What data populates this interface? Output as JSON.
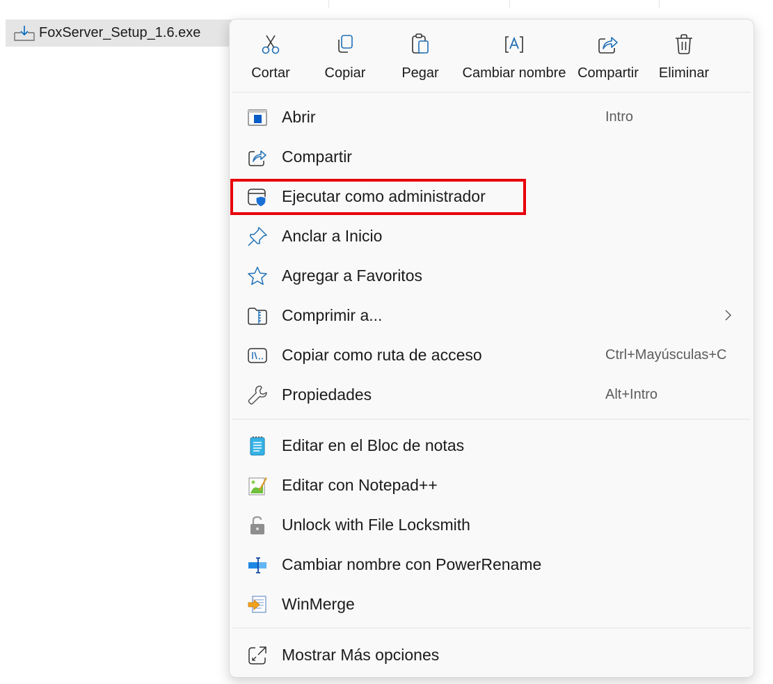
{
  "file": {
    "name": "FoxServer_Setup_1.6.exe",
    "icon": "download-file-icon"
  },
  "toolbar": [
    {
      "label": "Cortar",
      "icon": "scissors-icon"
    },
    {
      "label": "Copiar",
      "icon": "copy-icon"
    },
    {
      "label": "Pegar",
      "icon": "paste-icon"
    },
    {
      "label": "Cambiar nombre",
      "icon": "rename-icon"
    },
    {
      "label": "Compartir",
      "icon": "share-icon"
    },
    {
      "label": "Eliminar",
      "icon": "trash-icon"
    }
  ],
  "menu": {
    "group1": [
      {
        "label": "Abrir",
        "shortcut": "Intro",
        "icon": "open-window-icon"
      },
      {
        "label": "Compartir",
        "shortcut": "",
        "icon": "share-icon"
      },
      {
        "label": "Ejecutar como administrador",
        "shortcut": "",
        "icon": "shield-window-icon",
        "highlighted": true
      },
      {
        "label": "Anclar a Inicio",
        "shortcut": "",
        "icon": "pin-icon"
      },
      {
        "label": "Agregar a Favoritos",
        "shortcut": "",
        "icon": "star-icon"
      },
      {
        "label": "Comprimir a...",
        "shortcut": "",
        "icon": "zip-folder-icon",
        "submenu": true
      },
      {
        "label": "Copiar como ruta de acceso",
        "shortcut": "Ctrl+Mayúsculas+C",
        "icon": "path-icon"
      },
      {
        "label": "Propiedades",
        "shortcut": "Alt+Intro",
        "icon": "wrench-icon"
      }
    ],
    "group2": [
      {
        "label": "Editar en el Bloc de notas",
        "icon": "notepad-icon"
      },
      {
        "label": "Editar con Notepad++",
        "icon": "notepadpp-icon"
      },
      {
        "label": "Unlock with File Locksmith",
        "icon": "padlock-open-icon"
      },
      {
        "label": "Cambiar nombre con PowerRename",
        "icon": "powerrename-icon"
      },
      {
        "label": "WinMerge",
        "icon": "winmerge-icon"
      }
    ],
    "group3": [
      {
        "label": "Mostrar Más opciones",
        "icon": "expand-icon"
      }
    ]
  },
  "colors": {
    "highlight_border": "#e8000b",
    "accent_blue": "#0067c0",
    "menu_bg": "#f9f9f9",
    "file_row_bg": "#e5e5e5"
  }
}
